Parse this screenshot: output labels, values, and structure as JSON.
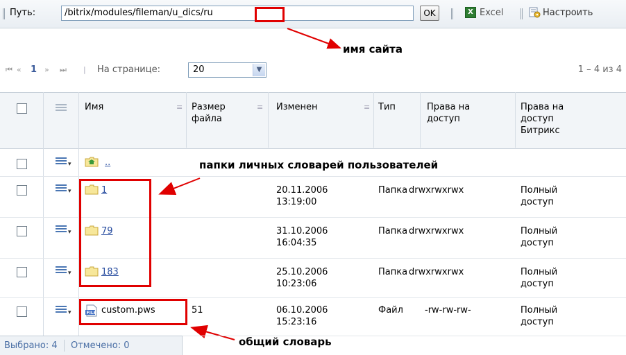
{
  "toolbar": {
    "path_label": "Путь:",
    "path_value": "/bitrix/modules/fileman/u_dics/ru",
    "ok_label": "OK",
    "excel_icon_text": "X",
    "excel_label": "Excel",
    "settings_label": "Настроить",
    "icons": {
      "excel": "excel-icon",
      "settings": "settings-icon"
    }
  },
  "annotations": {
    "site_name": "имя сайта",
    "user_dict_folders": "папки личных словарей пользователей",
    "common_dict": "общий словарь",
    "color": "#e00000"
  },
  "pager": {
    "first": "⏮",
    "prev": "«",
    "current_page": "1",
    "next": "»",
    "last": "⏭",
    "per_page_label": "На странице:",
    "per_page_value": "20",
    "range": "1 – 4 из 4"
  },
  "grid": {
    "columns": [
      {
        "key": "name",
        "label": "Имя"
      },
      {
        "key": "size",
        "label": "Размер файла"
      },
      {
        "key": "modified",
        "label": "Изменен"
      },
      {
        "key": "type",
        "label": "Тип"
      },
      {
        "key": "access",
        "label": "Права на доступ"
      },
      {
        "key": "bitrix_access",
        "label": "Права на доступ Битрикс"
      }
    ],
    "rows": [
      {
        "name": "..",
        "size": "",
        "date": "",
        "time": "",
        "type": "",
        "access": "",
        "b1": "",
        "b2": "",
        "icon": "folder-up-icon"
      },
      {
        "name": "1",
        "size": "",
        "date": "20.11.2006",
        "time": "13:19:00",
        "type": "Папка",
        "access": "drwxrwxrwx",
        "b1": "Полный",
        "b2": "доступ",
        "icon": "folder-icon"
      },
      {
        "name": "79",
        "size": "",
        "date": "31.10.2006",
        "time": "16:04:35",
        "type": "Папка",
        "access": "drwxrwxrwx",
        "b1": "Полный",
        "b2": "доступ",
        "icon": "folder-icon"
      },
      {
        "name": "183",
        "size": "",
        "date": "25.10.2006",
        "time": "10:23:06",
        "type": "Папка",
        "access": "drwxrwxrwx",
        "b1": "Полный",
        "b2": "доступ",
        "icon": "folder-icon"
      },
      {
        "name": "custom.pws",
        "size": "51",
        "date": "06.10.2006",
        "time": "15:23:16",
        "type": "Файл",
        "access": "-rw-rw-rw-",
        "b1": "Полный",
        "b2": "доступ",
        "icon": "file-icon"
      }
    ]
  },
  "status": {
    "selected": "Выбрано: 4",
    "marked": "Отмечено: 0"
  }
}
